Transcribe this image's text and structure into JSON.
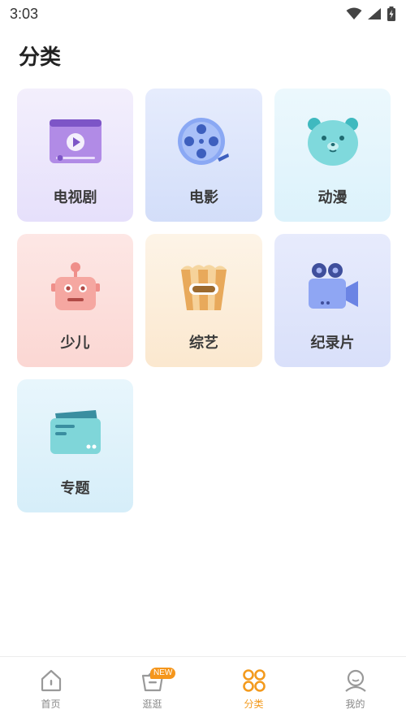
{
  "status": {
    "time": "3:03"
  },
  "title": "分类",
  "categories": [
    {
      "label": "电视剧",
      "icon": "tv-series-icon"
    },
    {
      "label": "电影",
      "icon": "film-reel-icon"
    },
    {
      "label": "动漫",
      "icon": "bear-face-icon"
    },
    {
      "label": "少儿",
      "icon": "robot-icon"
    },
    {
      "label": "综艺",
      "icon": "popcorn-icon"
    },
    {
      "label": "纪录片",
      "icon": "video-camera-icon"
    },
    {
      "label": "专题",
      "icon": "folder-card-icon"
    }
  ],
  "tabs": [
    {
      "label": "首页",
      "icon": "home-icon"
    },
    {
      "label": "逛逛",
      "icon": "basket-icon",
      "badge": "NEW"
    },
    {
      "label": "分类",
      "icon": "grid-circles-icon",
      "active": true
    },
    {
      "label": "我的",
      "icon": "user-icon"
    }
  ],
  "colors": {
    "accent": "#f39a1d",
    "badge": "#f5961c"
  }
}
